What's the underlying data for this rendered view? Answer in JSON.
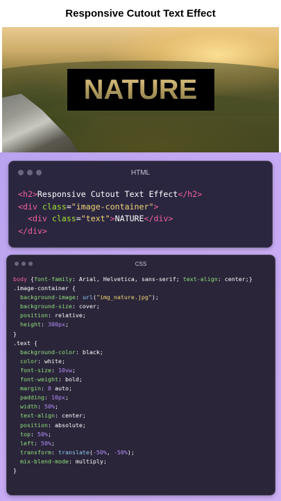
{
  "page": {
    "title": "Responsive Cutout Text Effect"
  },
  "image": {
    "cutout_text": "NATURE"
  },
  "html_panel": {
    "title": "HTML",
    "lines": [
      [
        {
          "t": "tag",
          "v": "<h2>"
        },
        {
          "t": "kw",
          "v": "Responsive Cutout Text Effect"
        },
        {
          "t": "tag",
          "v": "</h2>"
        }
      ],
      [
        {
          "t": "tag",
          "v": "<div "
        },
        {
          "t": "attr",
          "v": "class"
        },
        {
          "t": "kw",
          "v": "="
        },
        {
          "t": "str",
          "v": "\"image-container\""
        },
        {
          "t": "tag",
          "v": ">"
        }
      ],
      [
        {
          "t": "kw",
          "v": "  "
        },
        {
          "t": "tag",
          "v": "<div "
        },
        {
          "t": "attr",
          "v": "class"
        },
        {
          "t": "kw",
          "v": "="
        },
        {
          "t": "str",
          "v": "\"text\""
        },
        {
          "t": "tag",
          "v": ">"
        },
        {
          "t": "kw",
          "v": "NATURE"
        },
        {
          "t": "tag",
          "v": "</div>"
        }
      ],
      [
        {
          "t": "tag",
          "v": "</div>"
        }
      ]
    ]
  },
  "css_panel": {
    "title": "CSS",
    "lines": [
      [
        {
          "t": "tag",
          "v": "body "
        },
        {
          "t": "kw",
          "v": "{"
        },
        {
          "t": "prop",
          "v": "font-family"
        },
        {
          "t": "kw",
          "v": ": Arial, Helvetica, sans-serif; "
        },
        {
          "t": "prop",
          "v": "text-align"
        },
        {
          "t": "kw",
          "v": ": center;}"
        }
      ],
      [
        {
          "t": "sel",
          "v": ".image-container {"
        }
      ],
      [
        {
          "t": "kw",
          "v": "  "
        },
        {
          "t": "prop",
          "v": "background-image"
        },
        {
          "t": "kw",
          "v": ": "
        },
        {
          "t": "fn",
          "v": "url"
        },
        {
          "t": "kw",
          "v": "("
        },
        {
          "t": "str",
          "v": "\"img_nature.jpg\""
        },
        {
          "t": "kw",
          "v": ");"
        }
      ],
      [
        {
          "t": "kw",
          "v": "  "
        },
        {
          "t": "prop",
          "v": "background-size"
        },
        {
          "t": "kw",
          "v": ": cover;"
        }
      ],
      [
        {
          "t": "kw",
          "v": "  "
        },
        {
          "t": "prop",
          "v": "position"
        },
        {
          "t": "kw",
          "v": ": relative;"
        }
      ],
      [
        {
          "t": "kw",
          "v": "  "
        },
        {
          "t": "prop",
          "v": "height"
        },
        {
          "t": "kw",
          "v": ": "
        },
        {
          "t": "num",
          "v": "300px"
        },
        {
          "t": "kw",
          "v": ";"
        }
      ],
      [
        {
          "t": "kw",
          "v": "}"
        }
      ],
      [
        {
          "t": "sel",
          "v": ".text {"
        }
      ],
      [
        {
          "t": "kw",
          "v": "  "
        },
        {
          "t": "prop",
          "v": "background-color"
        },
        {
          "t": "kw",
          "v": ": black;"
        }
      ],
      [
        {
          "t": "kw",
          "v": "  "
        },
        {
          "t": "prop",
          "v": "color"
        },
        {
          "t": "kw",
          "v": ": white;"
        }
      ],
      [
        {
          "t": "kw",
          "v": "  "
        },
        {
          "t": "prop",
          "v": "font-size"
        },
        {
          "t": "kw",
          "v": ": "
        },
        {
          "t": "num",
          "v": "10vw"
        },
        {
          "t": "kw",
          "v": ";"
        }
      ],
      [
        {
          "t": "kw",
          "v": "  "
        },
        {
          "t": "prop",
          "v": "font-weight"
        },
        {
          "t": "kw",
          "v": ": bold;"
        }
      ],
      [
        {
          "t": "kw",
          "v": "  "
        },
        {
          "t": "prop",
          "v": "margin"
        },
        {
          "t": "kw",
          "v": ": "
        },
        {
          "t": "num",
          "v": "0"
        },
        {
          "t": "kw",
          "v": " auto;"
        }
      ],
      [
        {
          "t": "kw",
          "v": "  "
        },
        {
          "t": "prop",
          "v": "padding"
        },
        {
          "t": "kw",
          "v": ": "
        },
        {
          "t": "num",
          "v": "10px"
        },
        {
          "t": "kw",
          "v": ";"
        }
      ],
      [
        {
          "t": "kw",
          "v": "  "
        },
        {
          "t": "prop",
          "v": "width"
        },
        {
          "t": "kw",
          "v": ": "
        },
        {
          "t": "num",
          "v": "50%"
        },
        {
          "t": "kw",
          "v": ";"
        }
      ],
      [
        {
          "t": "kw",
          "v": "  "
        },
        {
          "t": "prop",
          "v": "text-align"
        },
        {
          "t": "kw",
          "v": ": center;"
        }
      ],
      [
        {
          "t": "kw",
          "v": "  "
        },
        {
          "t": "prop",
          "v": "position"
        },
        {
          "t": "kw",
          "v": ": absolute;"
        }
      ],
      [
        {
          "t": "kw",
          "v": "  "
        },
        {
          "t": "prop",
          "v": "top"
        },
        {
          "t": "kw",
          "v": ": "
        },
        {
          "t": "num",
          "v": "50%"
        },
        {
          "t": "kw",
          "v": ";"
        }
      ],
      [
        {
          "t": "kw",
          "v": "  "
        },
        {
          "t": "prop",
          "v": "left"
        },
        {
          "t": "kw",
          "v": ": "
        },
        {
          "t": "num",
          "v": "50%"
        },
        {
          "t": "kw",
          "v": ";"
        }
      ],
      [
        {
          "t": "kw",
          "v": "  "
        },
        {
          "t": "prop",
          "v": "transform"
        },
        {
          "t": "kw",
          "v": ": "
        },
        {
          "t": "fn",
          "v": "translate"
        },
        {
          "t": "kw",
          "v": "("
        },
        {
          "t": "num",
          "v": "-50%"
        },
        {
          "t": "kw",
          "v": ", "
        },
        {
          "t": "num",
          "v": "-50%"
        },
        {
          "t": "kw",
          "v": ");"
        }
      ],
      [
        {
          "t": "kw",
          "v": "  "
        },
        {
          "t": "prop",
          "v": "mix-blend-mode"
        },
        {
          "t": "kw",
          "v": ": multiply;"
        }
      ],
      [
        {
          "t": "kw",
          "v": "}"
        }
      ]
    ]
  }
}
